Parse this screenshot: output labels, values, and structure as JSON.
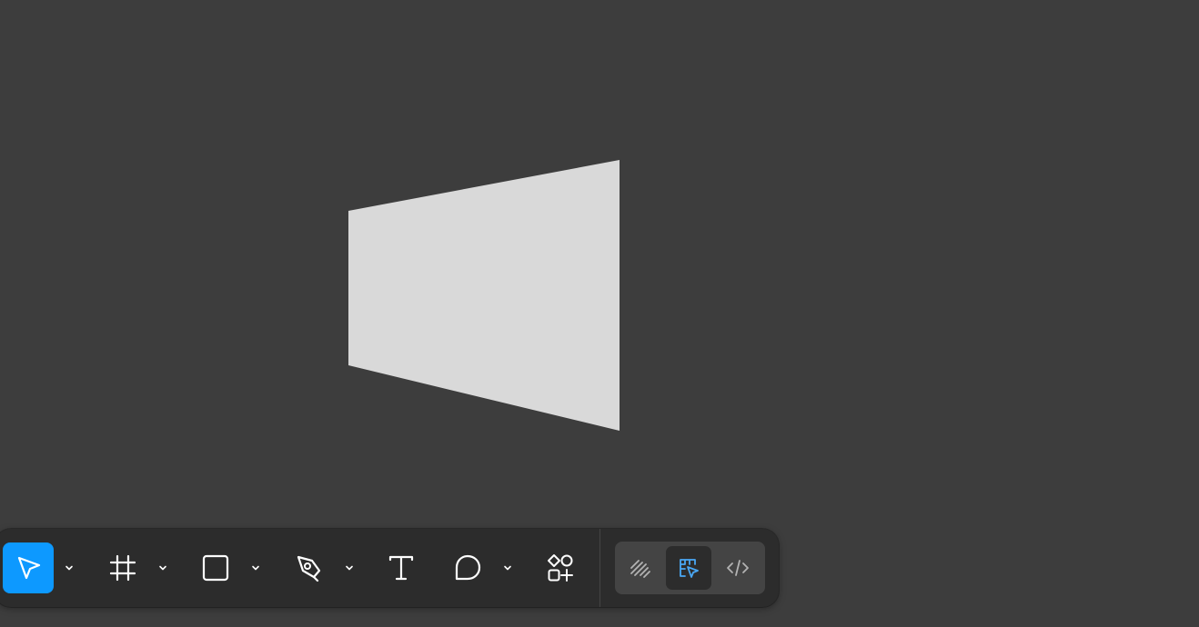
{
  "canvas": {
    "background": "#3d3d3d",
    "shape_fill": "#d9d9d9"
  },
  "toolbar": {
    "background": "#2c2c2c",
    "accent": "#0d99ff",
    "tools": [
      {
        "id": "move",
        "icon": "move-cursor-icon",
        "active": true,
        "has_dropdown": true
      },
      {
        "id": "frame",
        "icon": "frame-hash-icon",
        "active": false,
        "has_dropdown": true
      },
      {
        "id": "shape",
        "icon": "rectangle-icon",
        "active": false,
        "has_dropdown": true
      },
      {
        "id": "pen",
        "icon": "pen-icon",
        "active": false,
        "has_dropdown": true
      },
      {
        "id": "text",
        "icon": "text-icon",
        "active": false,
        "has_dropdown": false
      },
      {
        "id": "comment",
        "icon": "comment-bubble-icon",
        "active": false,
        "has_dropdown": true
      },
      {
        "id": "actions",
        "icon": "actions-shapes-icon",
        "active": false,
        "has_dropdown": false
      }
    ],
    "modes": [
      {
        "id": "draw",
        "icon": "draw-squiggle-icon",
        "active": false
      },
      {
        "id": "design",
        "icon": "design-ruler-cursor-icon",
        "active": true
      },
      {
        "id": "dev",
        "icon": "code-brackets-icon",
        "active": false
      }
    ]
  }
}
